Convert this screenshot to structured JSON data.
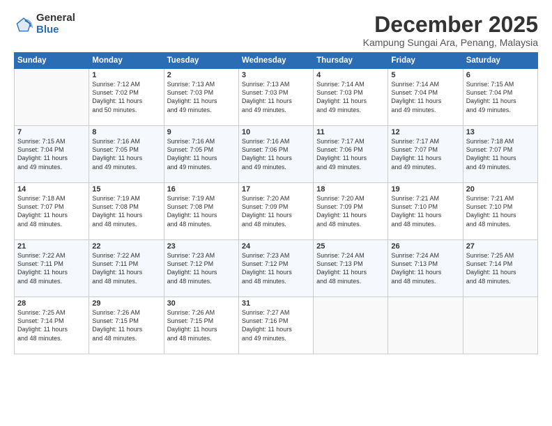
{
  "logo": {
    "general": "General",
    "blue": "Blue"
  },
  "title": "December 2025",
  "subtitle": "Kampung Sungai Ara, Penang, Malaysia",
  "days_header": [
    "Sunday",
    "Monday",
    "Tuesday",
    "Wednesday",
    "Thursday",
    "Friday",
    "Saturday"
  ],
  "weeks": [
    [
      {
        "day": "",
        "info": ""
      },
      {
        "day": "1",
        "info": "Sunrise: 7:12 AM\nSunset: 7:02 PM\nDaylight: 11 hours\nand 50 minutes."
      },
      {
        "day": "2",
        "info": "Sunrise: 7:13 AM\nSunset: 7:03 PM\nDaylight: 11 hours\nand 49 minutes."
      },
      {
        "day": "3",
        "info": "Sunrise: 7:13 AM\nSunset: 7:03 PM\nDaylight: 11 hours\nand 49 minutes."
      },
      {
        "day": "4",
        "info": "Sunrise: 7:14 AM\nSunset: 7:03 PM\nDaylight: 11 hours\nand 49 minutes."
      },
      {
        "day": "5",
        "info": "Sunrise: 7:14 AM\nSunset: 7:04 PM\nDaylight: 11 hours\nand 49 minutes."
      },
      {
        "day": "6",
        "info": "Sunrise: 7:15 AM\nSunset: 7:04 PM\nDaylight: 11 hours\nand 49 minutes."
      }
    ],
    [
      {
        "day": "7",
        "info": "Sunrise: 7:15 AM\nSunset: 7:04 PM\nDaylight: 11 hours\nand 49 minutes."
      },
      {
        "day": "8",
        "info": "Sunrise: 7:16 AM\nSunset: 7:05 PM\nDaylight: 11 hours\nand 49 minutes."
      },
      {
        "day": "9",
        "info": "Sunrise: 7:16 AM\nSunset: 7:05 PM\nDaylight: 11 hours\nand 49 minutes."
      },
      {
        "day": "10",
        "info": "Sunrise: 7:16 AM\nSunset: 7:06 PM\nDaylight: 11 hours\nand 49 minutes."
      },
      {
        "day": "11",
        "info": "Sunrise: 7:17 AM\nSunset: 7:06 PM\nDaylight: 11 hours\nand 49 minutes."
      },
      {
        "day": "12",
        "info": "Sunrise: 7:17 AM\nSunset: 7:07 PM\nDaylight: 11 hours\nand 49 minutes."
      },
      {
        "day": "13",
        "info": "Sunrise: 7:18 AM\nSunset: 7:07 PM\nDaylight: 11 hours\nand 49 minutes."
      }
    ],
    [
      {
        "day": "14",
        "info": "Sunrise: 7:18 AM\nSunset: 7:07 PM\nDaylight: 11 hours\nand 48 minutes."
      },
      {
        "day": "15",
        "info": "Sunrise: 7:19 AM\nSunset: 7:08 PM\nDaylight: 11 hours\nand 48 minutes."
      },
      {
        "day": "16",
        "info": "Sunrise: 7:19 AM\nSunset: 7:08 PM\nDaylight: 11 hours\nand 48 minutes."
      },
      {
        "day": "17",
        "info": "Sunrise: 7:20 AM\nSunset: 7:09 PM\nDaylight: 11 hours\nand 48 minutes."
      },
      {
        "day": "18",
        "info": "Sunrise: 7:20 AM\nSunset: 7:09 PM\nDaylight: 11 hours\nand 48 minutes."
      },
      {
        "day": "19",
        "info": "Sunrise: 7:21 AM\nSunset: 7:10 PM\nDaylight: 11 hours\nand 48 minutes."
      },
      {
        "day": "20",
        "info": "Sunrise: 7:21 AM\nSunset: 7:10 PM\nDaylight: 11 hours\nand 48 minutes."
      }
    ],
    [
      {
        "day": "21",
        "info": "Sunrise: 7:22 AM\nSunset: 7:11 PM\nDaylight: 11 hours\nand 48 minutes."
      },
      {
        "day": "22",
        "info": "Sunrise: 7:22 AM\nSunset: 7:11 PM\nDaylight: 11 hours\nand 48 minutes."
      },
      {
        "day": "23",
        "info": "Sunrise: 7:23 AM\nSunset: 7:12 PM\nDaylight: 11 hours\nand 48 minutes."
      },
      {
        "day": "24",
        "info": "Sunrise: 7:23 AM\nSunset: 7:12 PM\nDaylight: 11 hours\nand 48 minutes."
      },
      {
        "day": "25",
        "info": "Sunrise: 7:24 AM\nSunset: 7:13 PM\nDaylight: 11 hours\nand 48 minutes."
      },
      {
        "day": "26",
        "info": "Sunrise: 7:24 AM\nSunset: 7:13 PM\nDaylight: 11 hours\nand 48 minutes."
      },
      {
        "day": "27",
        "info": "Sunrise: 7:25 AM\nSunset: 7:14 PM\nDaylight: 11 hours\nand 48 minutes."
      }
    ],
    [
      {
        "day": "28",
        "info": "Sunrise: 7:25 AM\nSunset: 7:14 PM\nDaylight: 11 hours\nand 48 minutes."
      },
      {
        "day": "29",
        "info": "Sunrise: 7:26 AM\nSunset: 7:15 PM\nDaylight: 11 hours\nand 48 minutes."
      },
      {
        "day": "30",
        "info": "Sunrise: 7:26 AM\nSunset: 7:15 PM\nDaylight: 11 hours\nand 48 minutes."
      },
      {
        "day": "31",
        "info": "Sunrise: 7:27 AM\nSunset: 7:16 PM\nDaylight: 11 hours\nand 49 minutes."
      },
      {
        "day": "",
        "info": ""
      },
      {
        "day": "",
        "info": ""
      },
      {
        "day": "",
        "info": ""
      }
    ]
  ]
}
